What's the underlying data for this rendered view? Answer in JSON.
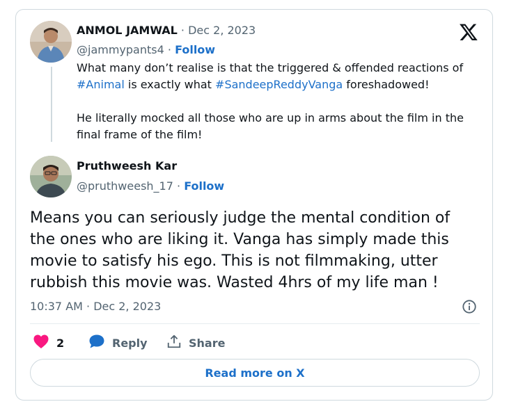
{
  "parent": {
    "name": "ANMOL JAMWAL",
    "date": "· Dec 2, 2023",
    "handle": "@jammypants4",
    "sep": "·",
    "follow": "Follow",
    "line1_pre": "What many don’t realise is that the triggered & offended reactions of",
    "hashtag1": "#Animal",
    "line2_mid": "is exactly what",
    "hashtag2": "#SandeepReddyVanga",
    "line2_post": "foreshadowed!",
    "para2_line1": "He literally mocked all those who are up in arms about the film in the",
    "para2_line2": "final frame of the film!"
  },
  "reply": {
    "name": "Pruthweesh Kar",
    "handle": "@pruthweesh_17",
    "sep": "·",
    "follow": "Follow",
    "text_lines": [
      "Means you can seriously judge the mental condition of",
      "the ones who are liking it. Vanga has simply made this",
      "movie to satisfy his ego. This is not filmmaking, utter",
      "rubbish this movie was. Wasted 4hrs of my life man !"
    ],
    "timestamp": "10:37 AM · Dec 2, 2023"
  },
  "actions": {
    "like_count": "2",
    "reply_label": "Reply",
    "share_label": "Share"
  },
  "read_more": "Read more on X",
  "colors": {
    "accent": "#1d70c9",
    "like": "#f91880",
    "muted": "#536471",
    "border": "#cfd9de"
  },
  "icons": [
    "x-logo-icon",
    "info-icon",
    "heart-icon",
    "reply-bubble-icon",
    "share-icon"
  ]
}
